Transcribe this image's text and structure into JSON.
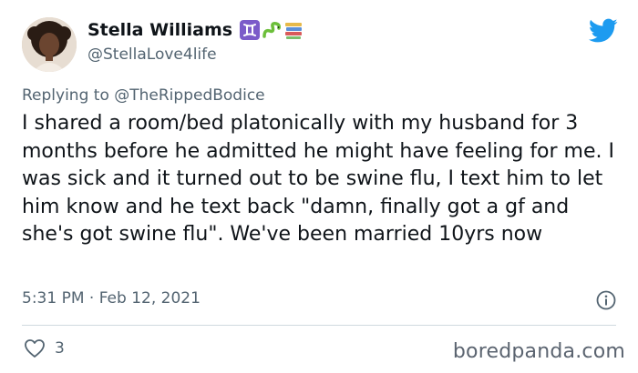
{
  "author": {
    "display_name": "Stella Williams",
    "handle": "@StellaLove4life",
    "emoji_icons": [
      "gemini-zodiac-icon",
      "snake-icon",
      "books-icon"
    ]
  },
  "reply": {
    "prefix": "Replying to",
    "mention": "@TheRippedBodice"
  },
  "tweet": {
    "text": "I shared a room/bed platonically with my husband for 3 months before he admitted he might have feeling for me. I was sick and it turned out to be swine flu, I text him to let him know and he text back \"damn, finally got a gf and she's got swine flu\". We've been married 10yrs now",
    "timestamp": "5:31 PM · Feb 12, 2021"
  },
  "engagement": {
    "likes": "3"
  },
  "watermark": "boredpanda.com",
  "colors": {
    "twitter_blue": "#1d9bf0",
    "text": "#0f1419",
    "secondary_text": "#536471",
    "divider": "#cfd9de"
  }
}
